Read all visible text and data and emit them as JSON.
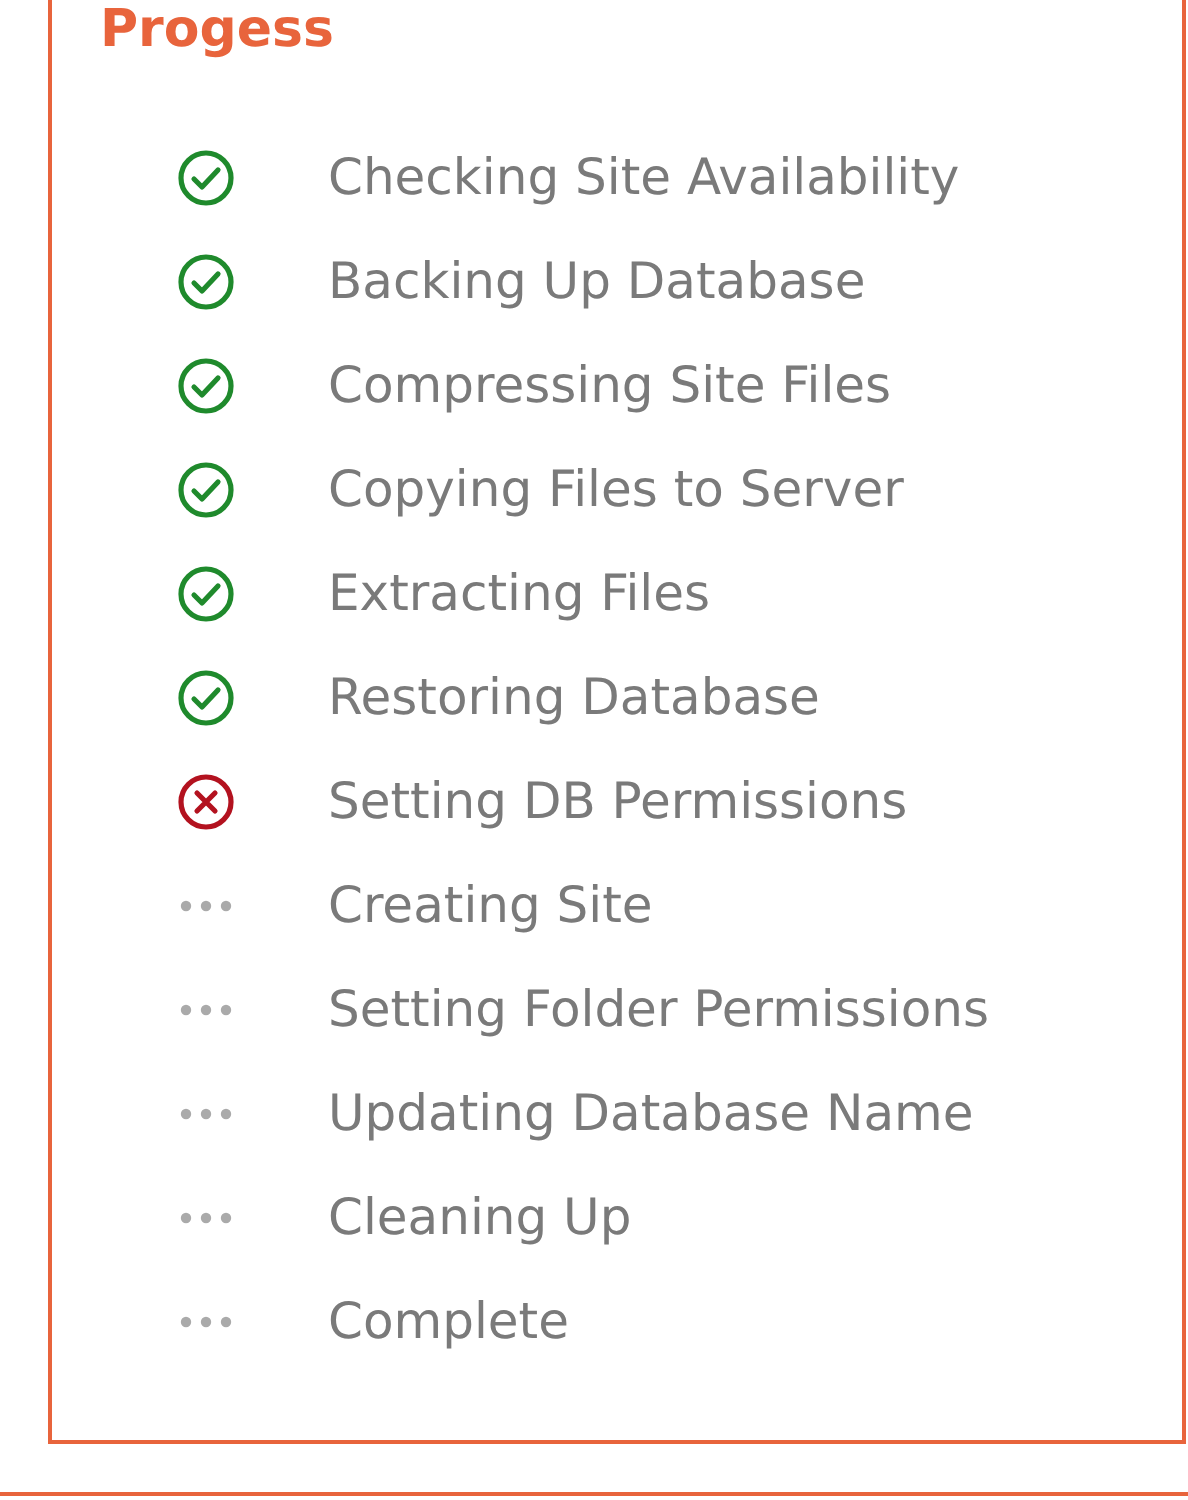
{
  "panel": {
    "title": "Progess"
  },
  "steps": [
    {
      "label": "Checking Site Availability",
      "kind": "done"
    },
    {
      "label": "Backing Up Database",
      "kind": "done"
    },
    {
      "label": "Compressing Site Files",
      "kind": "done"
    },
    {
      "label": "Copying Files to Server",
      "kind": "done"
    },
    {
      "label": "Extracting Files",
      "kind": "done"
    },
    {
      "label": "Restoring Database",
      "kind": "done"
    },
    {
      "label": "Setting DB Permissions",
      "kind": "failed"
    },
    {
      "label": "Creating Site",
      "kind": "pending"
    },
    {
      "label": "Setting Folder Permissions",
      "kind": "pending"
    },
    {
      "label": "Updating Database Name",
      "kind": "pending"
    },
    {
      "label": "Cleaning Up",
      "kind": "pending"
    },
    {
      "label": "Complete",
      "kind": "pending"
    }
  ]
}
